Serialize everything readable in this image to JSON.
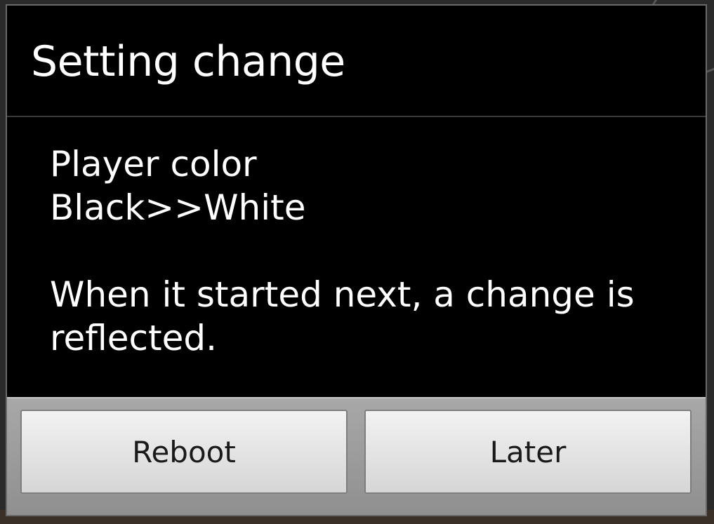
{
  "dialog": {
    "title": "Setting change",
    "message": {
      "line1": "Player color",
      "line2": "Black>>White",
      "line3": "When it started next, a change is reflected."
    },
    "buttons": {
      "reboot": "Reboot",
      "later": "Later"
    }
  },
  "colors": {
    "dialog_background": "#000000",
    "button_face": "#e4e4e4",
    "button_bar": "#9a9a9a",
    "text": "#ffffff"
  }
}
